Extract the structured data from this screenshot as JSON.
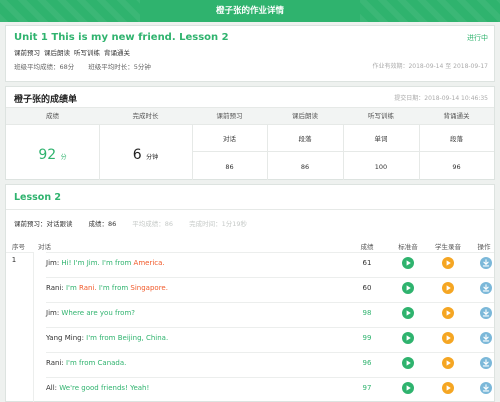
{
  "page_title": "橙子张的作业详情",
  "homework": {
    "title": "Unit 1 This is my new friend. Lesson 2",
    "status": "进行中",
    "tags": [
      "课前预习",
      "课后朗读",
      "听写训练",
      "背诵通关"
    ],
    "class_avg_score": "班级平均成绩：68分",
    "class_avg_time": "班级平均时长：5分钟",
    "date_range": "作业有效期：2018-09-14 至 2018-09-17"
  },
  "grades": {
    "title": "橙子张的成绩单",
    "submit_date": "提交日期：2018-09-14 10:46:35",
    "headers": [
      "成绩",
      "完成时长",
      "课前预习",
      "课后朗读",
      "听写训练",
      "背诵通关"
    ],
    "score_value": "92",
    "score_unit": "分",
    "time_value": "6",
    "time_unit": "分钟",
    "sub_types": [
      "对话",
      "段落",
      "单词",
      "段落"
    ],
    "sub_scores": [
      "86",
      "86",
      "100",
      "96"
    ]
  },
  "lesson": {
    "title": "Lesson 2",
    "section": "课前预习：对话跟读",
    "score": "成绩：86",
    "avg_score": "平均成绩：86",
    "duration": "完成时间：1分19秒",
    "col_seq": "序号",
    "col_dialog": "对话",
    "col_score": "成绩",
    "col_std": "标准音",
    "col_stu": "学生录音",
    "col_op": "操作",
    "seq": "1",
    "rows": [
      {
        "speaker": "Jim: ",
        "segments": [
          {
            "t": "Hi! I'm Jim. I'm from ",
            "c": "ok"
          },
          {
            "t": "America.",
            "c": "hl"
          }
        ],
        "score": "61",
        "ok": false
      },
      {
        "speaker": "Rani: ",
        "segments": [
          {
            "t": "I'm ",
            "c": "ok"
          },
          {
            "t": "Rani.",
            "c": "hl"
          },
          {
            "t": " I'm from ",
            "c": "ok"
          },
          {
            "t": "Singapore.",
            "c": "hl"
          }
        ],
        "score": "60",
        "ok": false
      },
      {
        "speaker": "Jim: ",
        "segments": [
          {
            "t": "Where are you from?",
            "c": "ok"
          }
        ],
        "score": "98",
        "ok": true
      },
      {
        "speaker": "Yang Ming: ",
        "segments": [
          {
            "t": "I'm from Beijing, China.",
            "c": "ok"
          }
        ],
        "score": "99",
        "ok": true
      },
      {
        "speaker": "Rani: ",
        "segments": [
          {
            "t": "I'm from Canada.",
            "c": "ok"
          }
        ],
        "score": "96",
        "ok": true
      },
      {
        "speaker": "All: ",
        "segments": [
          {
            "t": "We're good friends! Yeah!",
            "c": "ok"
          }
        ],
        "score": "97",
        "ok": true
      }
    ]
  },
  "colors": {
    "brand": "#2fb36e",
    "highlight": "#f15a2a",
    "student": "#f5a623",
    "download": "#7bb8d9"
  },
  "icons": {
    "standard_audio": "play-icon",
    "student_audio": "play-icon",
    "operation": "download-icon"
  }
}
